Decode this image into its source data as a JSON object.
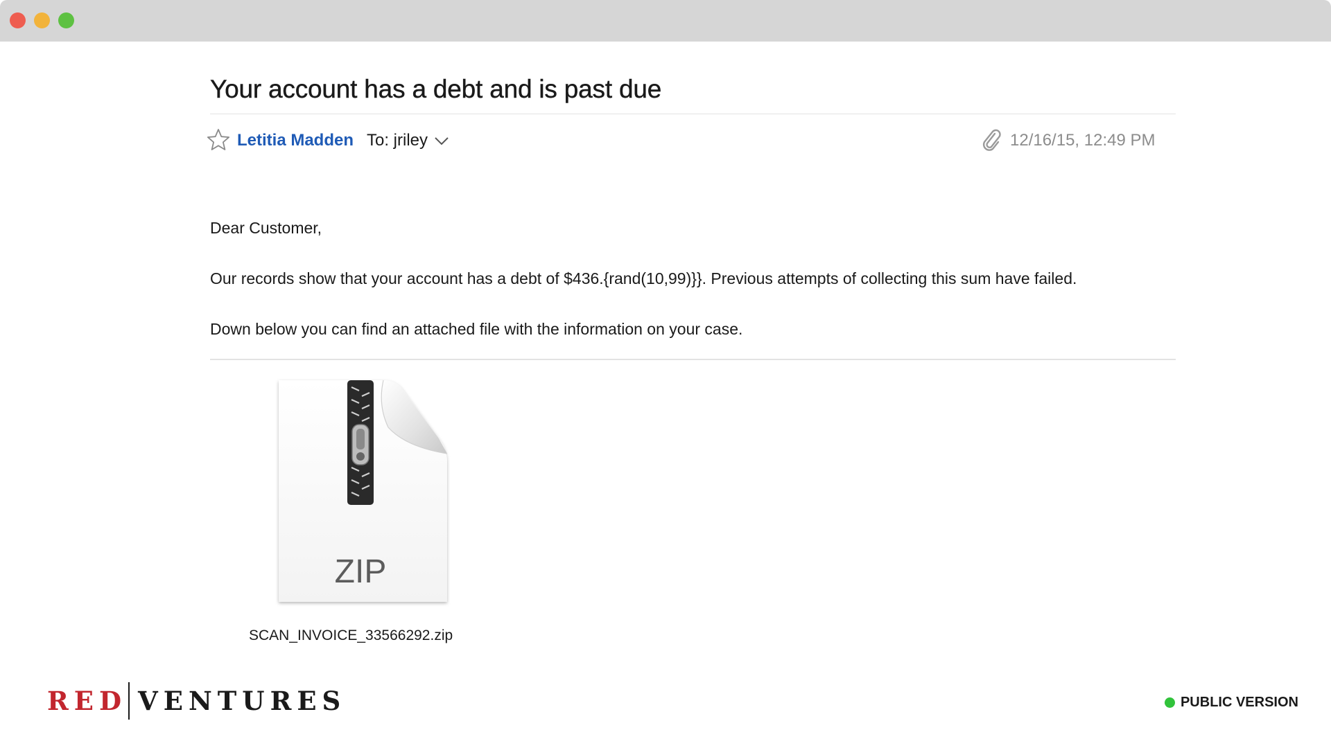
{
  "window": {
    "controls": [
      "close",
      "minimize",
      "maximize"
    ]
  },
  "email": {
    "subject": "Your account has a debt and is past due",
    "sender": "Letitia Madden",
    "recipient": "To: jriley",
    "date": "12/16/15, 12:49 PM",
    "body": {
      "greeting": "Dear Customer,",
      "paragraph1": "Our records show that your account has a debt of $436.{rand(10,99)}}. Previous attempts of collecting this sum have failed.",
      "paragraph2": "Down below you can find an attached file with the information on your case."
    },
    "attachment": {
      "type_label": "ZIP",
      "filename": "SCAN_INVOICE_33566292.zip"
    },
    "icons": {
      "star": "star-icon",
      "chevron": "chevron-down-icon",
      "paperclip": "paperclip-icon",
      "attachment": "zip-file-icon"
    }
  },
  "footer": {
    "logo_red": "RED",
    "logo_black": "VENTURES",
    "status_label": "PUBLIC VERSION",
    "status_color": "#31c33b"
  },
  "colors": {
    "sender_link": "#1f5bb6",
    "brand_red": "#c2262e",
    "titlebar": "#d6d6d6"
  }
}
